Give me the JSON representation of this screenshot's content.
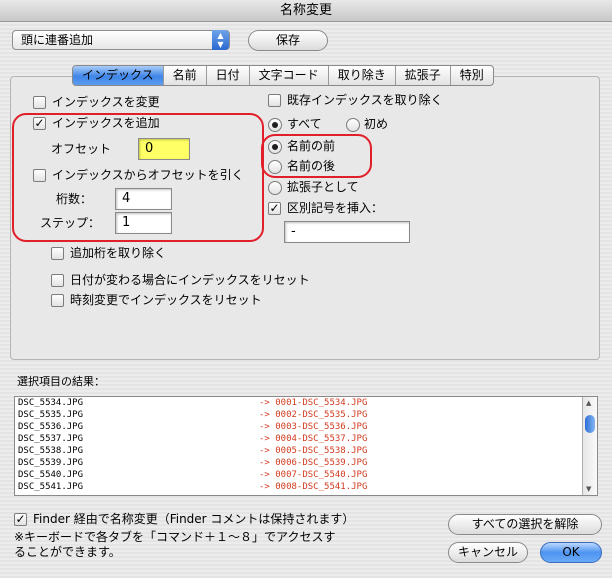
{
  "window": {
    "title": "名称変更"
  },
  "toolbar": {
    "preset_value": "頭に連番追加",
    "save_label": "保存"
  },
  "tabs": [
    {
      "label": "インデックス",
      "active": true
    },
    {
      "label": "名前"
    },
    {
      "label": "日付"
    },
    {
      "label": "文字コード"
    },
    {
      "label": "取り除き"
    },
    {
      "label": "拡張子"
    },
    {
      "label": "特別"
    }
  ],
  "index_tab": {
    "change_index": {
      "label": "インデックスを変更",
      "checked": false
    },
    "add_index": {
      "label": "インデックスを追加",
      "checked": true
    },
    "offset_label": "オフセット",
    "offset_value": "0",
    "subtract_offset": {
      "label": "インデックスからオフセットを引く",
      "checked": false
    },
    "digits_label": "桁数：",
    "digits_value": "4",
    "step_label": "ステップ：",
    "step_value": "1",
    "remove_added_digits": {
      "label": "追加桁を取り除く",
      "checked": false
    },
    "reset_on_date_change": {
      "label": "日付が変わる場合にインデックスをリセット",
      "checked": false
    },
    "reset_on_time_change": {
      "label": "時刻変更でインデックスをリセット",
      "checked": false
    },
    "remove_existing_index": {
      "label": "既存インデックスを取り除く",
      "checked": false
    },
    "scope_all": {
      "label": "すべて",
      "selected": true
    },
    "scope_first": {
      "label": "初め",
      "selected": false
    },
    "pos_before_name": {
      "label": "名前の前",
      "selected": true
    },
    "pos_after_name": {
      "label": "名前の後",
      "selected": false
    },
    "pos_as_extension": {
      "label": "拡張子として",
      "selected": false
    },
    "insert_separator": {
      "label": "区別記号を挿入：",
      "checked": true
    },
    "separator_value": "-"
  },
  "results": {
    "label": "選択項目の結果：",
    "rows": [
      {
        "src": "DSC_5534.JPG",
        "dst": "-> 0001-DSC_5534.JPG"
      },
      {
        "src": "DSC_5535.JPG",
        "dst": "-> 0002-DSC_5535.JPG"
      },
      {
        "src": "DSC_5536.JPG",
        "dst": "-> 0003-DSC_5536.JPG"
      },
      {
        "src": "DSC_5537.JPG",
        "dst": "-> 0004-DSC_5537.JPG"
      },
      {
        "src": "DSC_5538.JPG",
        "dst": "-> 0005-DSC_5538.JPG"
      },
      {
        "src": "DSC_5539.JPG",
        "dst": "-> 0006-DSC_5539.JPG"
      },
      {
        "src": "DSC_5540.JPG",
        "dst": "-> 0007-DSC_5540.JPG"
      },
      {
        "src": "DSC_5541.JPG",
        "dst": "-> 0008-DSC_5541.JPG"
      }
    ]
  },
  "footer": {
    "finder_rename": {
      "label": "Finder 経由で名称変更（Finder コメントは保持されます）",
      "checked": true
    },
    "hint_line1": "※キーボードで各タブを「コマンド＋１〜８」でアクセスす",
    "hint_line2": "ることができます。",
    "deselect_all_label": "すべての選択を解除",
    "cancel_label": "キャンセル",
    "ok_label": "OK"
  },
  "colors": {
    "highlight": "#e01f2b",
    "accent": "#3f86e8",
    "result_text": "#d23a1e",
    "offset_field": "#ffff66"
  }
}
